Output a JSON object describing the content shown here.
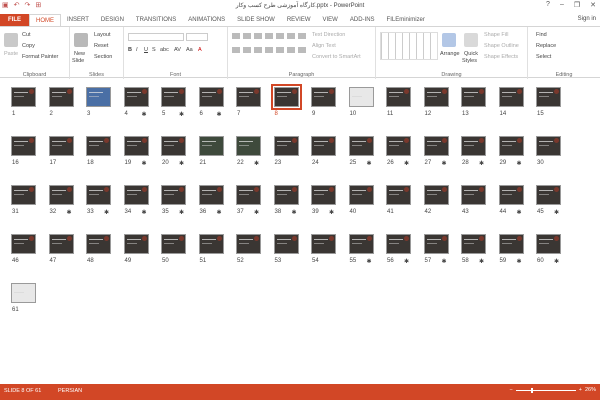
{
  "window": {
    "title": "کارگاه آموزشی طرح کسب وکار.pptx - PowerPoint",
    "minimize": "–",
    "restore": "❐",
    "close": "✕",
    "help": "?"
  },
  "qat": [
    "▣",
    "↶",
    "↷",
    "⊞"
  ],
  "tabs": [
    "FILE",
    "HOME",
    "INSERT",
    "DESIGN",
    "TRANSITIONS",
    "ANIMATIONS",
    "SLIDE SHOW",
    "REVIEW",
    "VIEW",
    "ADD-INS",
    "FILEminimizer"
  ],
  "active_tab": "HOME",
  "signin": "Sign in",
  "ribbon": {
    "clipboard": {
      "label": "Clipboard",
      "paste": "Paste",
      "cut": "Cut",
      "copy": "Copy",
      "format_painter": "Format Painter"
    },
    "slides": {
      "label": "Slides",
      "new_slide": "New",
      "new_slide2": "Slide",
      "layout": "Layout",
      "reset": "Reset",
      "section": "Section"
    },
    "font": {
      "label": "Font",
      "b": "B",
      "i": "I",
      "u": "U",
      "s": "S",
      "abc": "abc",
      "av": "AV",
      "aa": "Aa",
      "a": "A"
    },
    "paragraph": {
      "label": "Paragraph",
      "text_direction": "Text Direction",
      "align_text": "Align Text",
      "convert": "Convert to SmartArt"
    },
    "drawing": {
      "label": "Drawing",
      "arrange": "Arrange",
      "quick_styles": "Quick",
      "quick_styles2": "Styles",
      "shape_fill": "Shape Fill",
      "shape_outline": "Shape Outline",
      "shape_effects": "Shape Effects"
    },
    "editing": {
      "label": "Editing",
      "find": "Find",
      "replace": "Replace",
      "select": "Select"
    }
  },
  "slides": [
    {
      "n": "1",
      "star": false,
      "style": "dark"
    },
    {
      "n": "2",
      "star": false,
      "style": "dark"
    },
    {
      "n": "3",
      "star": false,
      "style": "blue"
    },
    {
      "n": "4",
      "star": true,
      "style": "dark"
    },
    {
      "n": "5",
      "star": true,
      "style": "dark"
    },
    {
      "n": "6",
      "star": true,
      "style": "dark"
    },
    {
      "n": "7",
      "star": false,
      "style": "dark"
    },
    {
      "n": "8",
      "star": false,
      "style": "dark"
    },
    {
      "n": "9",
      "star": false,
      "style": "dark"
    },
    {
      "n": "10",
      "star": false,
      "style": "light"
    },
    {
      "n": "11",
      "star": false,
      "style": "dark"
    },
    {
      "n": "12",
      "star": false,
      "style": "dark"
    },
    {
      "n": "13",
      "star": false,
      "style": "dark"
    },
    {
      "n": "14",
      "star": false,
      "style": "dark"
    },
    {
      "n": "15",
      "star": false,
      "style": "dark"
    },
    {
      "n": "16",
      "star": false,
      "style": "dark"
    },
    {
      "n": "17",
      "star": false,
      "style": "dark"
    },
    {
      "n": "18",
      "star": false,
      "style": "dark"
    },
    {
      "n": "19",
      "star": true,
      "style": "dark"
    },
    {
      "n": "20",
      "star": true,
      "style": "dark"
    },
    {
      "n": "21",
      "star": false,
      "style": "green"
    },
    {
      "n": "22",
      "star": true,
      "style": "green"
    },
    {
      "n": "23",
      "star": false,
      "style": "dark"
    },
    {
      "n": "24",
      "star": false,
      "style": "dark"
    },
    {
      "n": "25",
      "star": true,
      "style": "dark"
    },
    {
      "n": "26",
      "star": true,
      "style": "dark"
    },
    {
      "n": "27",
      "star": true,
      "style": "dark"
    },
    {
      "n": "28",
      "star": true,
      "style": "dark"
    },
    {
      "n": "29",
      "star": true,
      "style": "dark"
    },
    {
      "n": "30",
      "star": false,
      "style": "dark"
    },
    {
      "n": "31",
      "star": false,
      "style": "dark"
    },
    {
      "n": "32",
      "star": true,
      "style": "dark"
    },
    {
      "n": "33",
      "star": true,
      "style": "dark"
    },
    {
      "n": "34",
      "star": true,
      "style": "dark"
    },
    {
      "n": "35",
      "star": true,
      "style": "dark"
    },
    {
      "n": "36",
      "star": true,
      "style": "dark"
    },
    {
      "n": "37",
      "star": true,
      "style": "dark"
    },
    {
      "n": "38",
      "star": true,
      "style": "dark"
    },
    {
      "n": "39",
      "star": true,
      "style": "dark"
    },
    {
      "n": "40",
      "star": false,
      "style": "dark"
    },
    {
      "n": "41",
      "star": false,
      "style": "dark"
    },
    {
      "n": "42",
      "star": false,
      "style": "dark"
    },
    {
      "n": "43",
      "star": false,
      "style": "dark"
    },
    {
      "n": "44",
      "star": true,
      "style": "dark"
    },
    {
      "n": "45",
      "star": true,
      "style": "dark"
    },
    {
      "n": "46",
      "star": false,
      "style": "dark"
    },
    {
      "n": "47",
      "star": false,
      "style": "dark"
    },
    {
      "n": "48",
      "star": false,
      "style": "dark"
    },
    {
      "n": "49",
      "star": false,
      "style": "dark"
    },
    {
      "n": "50",
      "star": false,
      "style": "dark"
    },
    {
      "n": "51",
      "star": false,
      "style": "dark"
    },
    {
      "n": "52",
      "star": false,
      "style": "dark"
    },
    {
      "n": "53",
      "star": false,
      "style": "dark"
    },
    {
      "n": "54",
      "star": false,
      "style": "dark"
    },
    {
      "n": "55",
      "star": true,
      "style": "dark"
    },
    {
      "n": "56",
      "star": true,
      "style": "dark"
    },
    {
      "n": "57",
      "star": true,
      "style": "dark"
    },
    {
      "n": "58",
      "star": true,
      "style": "dark"
    },
    {
      "n": "59",
      "star": true,
      "style": "dark"
    },
    {
      "n": "60",
      "star": true,
      "style": "dark"
    },
    {
      "n": "61",
      "star": false,
      "style": "light"
    }
  ],
  "selected_slide": "8",
  "star_glyph": "✱",
  "status": {
    "slide": "SLIDE 8 OF 61",
    "lang": "PERSIAN",
    "zoom": "26%",
    "zoom_level": 0.26
  },
  "colors": {
    "accent": "#d24726"
  }
}
